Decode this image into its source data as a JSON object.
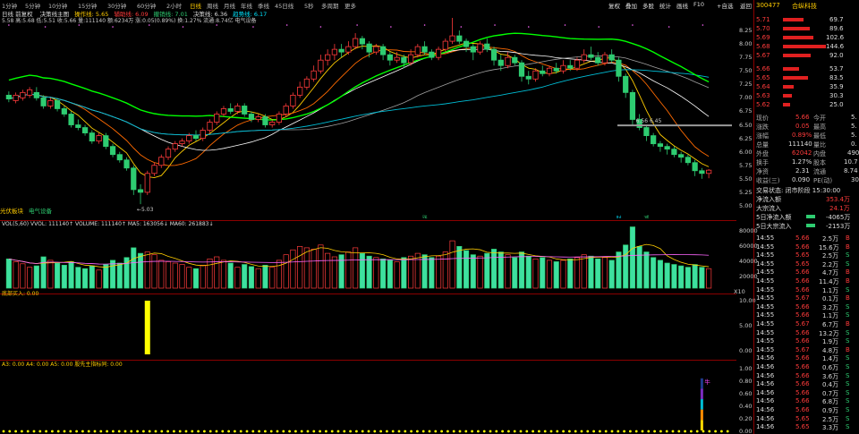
{
  "toolbar": {
    "periods": [
      "1分钟",
      "5分钟",
      "10分钟",
      "15分钟",
      "30分钟",
      "60分钟",
      "2小时",
      "日线",
      "周线",
      "月线",
      "年线",
      "季线",
      "45日线",
      "5秒",
      "多周期",
      "更多"
    ],
    "active_period": "日线",
    "right": [
      "复权",
      "叠加",
      "多股",
      "统计",
      "画线",
      "F10",
      "+自选",
      "返回"
    ]
  },
  "info_row": {
    "title": "日线 前复权",
    "items": [
      {
        "t": "决策线主图",
        "c": "#ddd"
      },
      {
        "t": "操作线: 5.65",
        "c": "#ffcc00"
      },
      {
        "t": "辅助线: 6.09",
        "c": "#ff3b3b"
      },
      {
        "t": "撤销线: 7.01",
        "c": "#2ecc71"
      },
      {
        "t": "决策线: 6.36",
        "c": "#ddd"
      },
      {
        "t": "趋势线: 6.17",
        "c": "#00e5ff"
      }
    ]
  },
  "info_row2": "5.58 高:5.68 低:5.51 收:5.66 量:111140 额:6234万 涨:0.05(0.89%) 换:1.27% 流通:8.74亿 电气设备",
  "sector_labels": [
    "光伏板块",
    "电气设备"
  ],
  "stock": {
    "code": "300477",
    "name": "合纵科技"
  },
  "order_book": {
    "asks": [
      {
        "label": "卖5",
        "price": "5.71",
        "vol": "69.7"
      },
      {
        "label": "卖4",
        "price": "5.70",
        "vol": "89.6"
      },
      {
        "label": "卖3",
        "price": "5.69",
        "vol": "102.6"
      },
      {
        "label": "卖2",
        "price": "5.68",
        "vol": "144.6"
      },
      {
        "label": "卖1",
        "price": "5.67",
        "vol": "92.0"
      }
    ],
    "bids": [
      {
        "label": "买1",
        "price": "5.66",
        "vol": "53.7"
      },
      {
        "label": "买2",
        "price": "5.65",
        "vol": "83.5"
      },
      {
        "label": "买3",
        "price": "5.64",
        "vol": "35.9"
      },
      {
        "label": "买4",
        "price": "5.63",
        "vol": "30.3"
      },
      {
        "label": "买5",
        "price": "5.62",
        "vol": "25.0"
      }
    ]
  },
  "quote": [
    [
      "现价",
      "5.66",
      "今开",
      "5."
    ],
    [
      "涨跌",
      "0.05",
      "最高",
      "5."
    ],
    [
      "涨幅",
      "0.89%",
      "最低",
      "5."
    ],
    [
      "总量",
      "111140",
      "量比",
      "0."
    ],
    [
      "外盘",
      "62042",
      "内盘",
      "490"
    ],
    [
      "换手",
      "1.27%",
      "股本",
      "10.7"
    ],
    [
      "净资",
      "2.31",
      "流通",
      "8.74"
    ],
    [
      "收益(三)",
      "0.090",
      "PE(动)",
      "30"
    ]
  ],
  "trade_status": "交易状态: 闭市阶段 15:30:00",
  "flows": [
    {
      "label": "净流入额",
      "value": "353.4万"
    },
    {
      "label": "大宗流入",
      "value": "24.1万"
    },
    {
      "label": "5日净流入额",
      "value": "-4065万"
    },
    {
      "label": "5日大宗流入",
      "value": "-2153万"
    }
  ],
  "ticks": [
    [
      "14:55",
      "5.66",
      "2.5万",
      "B"
    ],
    [
      "14:55",
      "5.66",
      "15.6万",
      "B"
    ],
    [
      "14:55",
      "5.65",
      "2.5万",
      "S"
    ],
    [
      "14:55",
      "5.65",
      "2.2万",
      "S"
    ],
    [
      "14:55",
      "5.66",
      "4.7万",
      "B"
    ],
    [
      "14:55",
      "5.66",
      "11.4万",
      "B"
    ],
    [
      "14:55",
      "5.66",
      "1.1万",
      "S"
    ],
    [
      "14:55",
      "5.67",
      "0.1万",
      "B"
    ],
    [
      "14:55",
      "5.66",
      "3.2万",
      "S"
    ],
    [
      "14:55",
      "5.66",
      "1.1万",
      "S"
    ],
    [
      "14:55",
      "5.67",
      "6.7万",
      "B"
    ],
    [
      "14:55",
      "5.66",
      "13.2万",
      "S"
    ],
    [
      "14:55",
      "5.66",
      "1.9万",
      "S"
    ],
    [
      "14:55",
      "5.67",
      "4.8万",
      "B"
    ],
    [
      "14:56",
      "5.66",
      "1.4万",
      "S"
    ],
    [
      "14:56",
      "5.66",
      "0.6万",
      "S"
    ],
    [
      "14:56",
      "5.66",
      "3.6万",
      "S"
    ],
    [
      "14:56",
      "5.66",
      "0.4万",
      "S"
    ],
    [
      "14:56",
      "5.66",
      "0.7万",
      "S"
    ],
    [
      "14:56",
      "5.66",
      "6.8万",
      "S"
    ],
    [
      "14:56",
      "5.66",
      "0.9万",
      "S"
    ],
    [
      "14:56",
      "5.65",
      "2.5万",
      "S"
    ],
    [
      "14:56",
      "5.65",
      "3.3万",
      "S"
    ]
  ],
  "price_axis": {
    "labels": [
      "8.25",
      "8.00",
      "7.75",
      "7.50",
      "7.25",
      "7.00",
      "6.75",
      "6.50",
      "6.25",
      "6.00",
      "5.75",
      "5.50",
      "5.25",
      "5.00"
    ]
  },
  "vol_header": "VOL(5,60) VVOL: 111140↑ VOLUME: 111140↑ MA5: 163056↓ MA60: 261883↓",
  "vol_axis": [
    "80000",
    "60000",
    "40000",
    "20000",
    "X10"
  ],
  "ind1_header": "底部买入: 0.00",
  "ind1_axis": [
    "10.00",
    "5.00",
    "0.00"
  ],
  "ind2_header": "A3: 0.00 A4: 0.00 A5: 0.00 股先主指标同: 0.00",
  "ind2_axis": [
    "1.00",
    "0.80",
    "0.60",
    "0.40",
    "0.20",
    "0.00"
  ],
  "annotations": {
    "high": "8.76",
    "low": "5.03",
    "mark": "6.56 6.45",
    "markers": [
      "涨",
      "财",
      "减"
    ],
    "signal": "牛"
  },
  "chart_data": {
    "type": "candlestick",
    "ylim": [
      4.9,
      8.35
    ],
    "candles": [
      [
        7.05,
        6.98,
        7.12,
        6.92
      ],
      [
        6.95,
        7.05,
        7.1,
        6.9
      ],
      [
        7.0,
        7.1,
        7.15,
        6.95
      ],
      [
        7.05,
        7.15,
        7.2,
        7.0
      ],
      [
        7.1,
        7.0,
        7.2,
        6.95
      ],
      [
        7.0,
        6.85,
        7.05,
        6.8
      ],
      [
        6.85,
        6.95,
        7.0,
        6.8
      ],
      [
        6.95,
        6.8,
        7.0,
        6.75
      ],
      [
        6.8,
        6.7,
        6.85,
        6.65
      ],
      [
        6.7,
        6.5,
        6.75,
        6.45
      ],
      [
        6.5,
        6.45,
        6.6,
        6.4
      ],
      [
        6.45,
        6.35,
        6.5,
        6.3
      ],
      [
        6.35,
        6.2,
        6.4,
        6.15
      ],
      [
        6.2,
        6.3,
        6.35,
        6.15
      ],
      [
        6.3,
        6.1,
        6.35,
        6.05
      ],
      [
        6.1,
        5.95,
        6.15,
        5.9
      ],
      [
        5.95,
        5.85,
        6.0,
        5.8
      ],
      [
        5.85,
        5.7,
        5.9,
        5.65
      ],
      [
        5.7,
        5.3,
        5.75,
        5.2
      ],
      [
        5.3,
        5.25,
        5.4,
        5.03
      ],
      [
        5.25,
        5.6,
        5.65,
        5.2
      ],
      [
        5.6,
        5.75,
        5.8,
        5.55
      ],
      [
        5.75,
        5.9,
        5.95,
        5.7
      ],
      [
        5.9,
        6.05,
        6.1,
        5.85
      ],
      [
        6.05,
        6.15,
        6.2,
        6.0
      ],
      [
        6.15,
        6.2,
        6.25,
        6.1
      ],
      [
        6.2,
        6.3,
        6.35,
        6.15
      ],
      [
        6.3,
        6.25,
        6.4,
        6.2
      ],
      [
        6.25,
        6.4,
        6.45,
        6.2
      ],
      [
        6.4,
        6.55,
        6.6,
        6.35
      ],
      [
        6.55,
        6.7,
        6.75,
        6.5
      ],
      [
        6.7,
        6.8,
        6.85,
        6.65
      ],
      [
        6.8,
        6.75,
        6.9,
        6.7
      ],
      [
        6.75,
        6.85,
        6.9,
        6.7
      ],
      [
        6.85,
        6.7,
        6.9,
        6.65
      ],
      [
        6.7,
        6.6,
        6.75,
        6.55
      ],
      [
        6.6,
        6.65,
        6.7,
        6.55
      ],
      [
        6.65,
        6.5,
        6.7,
        6.45
      ],
      [
        6.5,
        6.55,
        6.6,
        6.45
      ],
      [
        6.55,
        6.7,
        6.75,
        6.5
      ],
      [
        6.7,
        6.85,
        6.9,
        6.65
      ],
      [
        6.85,
        7.05,
        7.1,
        6.8
      ],
      [
        7.05,
        7.2,
        7.3,
        7.0
      ],
      [
        7.2,
        7.35,
        7.4,
        7.15
      ],
      [
        7.35,
        7.5,
        7.6,
        7.3
      ],
      [
        7.5,
        7.7,
        7.8,
        7.45
      ],
      [
        7.7,
        7.8,
        7.9,
        7.6
      ],
      [
        7.8,
        7.9,
        8.0,
        7.7
      ],
      [
        7.9,
        7.85,
        8.0,
        7.75
      ],
      [
        7.85,
        7.95,
        8.05,
        7.8
      ],
      [
        7.95,
        8.1,
        8.2,
        7.9
      ],
      [
        8.1,
        8.0,
        8.15,
        7.9
      ],
      [
        8.0,
        7.85,
        8.05,
        7.75
      ],
      [
        7.85,
        7.95,
        8.0,
        7.8
      ],
      [
        7.95,
        7.8,
        8.0,
        7.7
      ],
      [
        7.8,
        7.7,
        7.85,
        7.6
      ],
      [
        7.7,
        7.75,
        7.85,
        7.65
      ],
      [
        7.75,
        7.65,
        7.8,
        7.55
      ],
      [
        7.65,
        7.8,
        7.9,
        7.6
      ],
      [
        7.8,
        7.95,
        8.0,
        7.75
      ],
      [
        7.95,
        7.85,
        8.05,
        7.8
      ],
      [
        7.85,
        7.75,
        7.9,
        7.7
      ],
      [
        7.75,
        7.9,
        7.95,
        7.7
      ],
      [
        7.9,
        8.05,
        8.1,
        7.85
      ],
      [
        8.05,
        8.15,
        8.76,
        8.0
      ],
      [
        8.15,
        8.05,
        8.25,
        8.0
      ],
      [
        8.05,
        7.95,
        8.1,
        7.85
      ],
      [
        7.95,
        7.85,
        8.0,
        7.7
      ],
      [
        7.85,
        8.0,
        8.05,
        7.8
      ],
      [
        8.0,
        7.9,
        8.1,
        7.85
      ],
      [
        7.9,
        7.7,
        7.95,
        7.6
      ],
      [
        7.7,
        7.6,
        7.8,
        7.5
      ],
      [
        7.6,
        7.75,
        7.85,
        7.55
      ],
      [
        7.75,
        7.65,
        7.8,
        7.6
      ],
      [
        7.65,
        7.4,
        7.7,
        7.3
      ],
      [
        7.4,
        7.35,
        7.5,
        7.25
      ],
      [
        7.35,
        7.5,
        7.55,
        7.3
      ],
      [
        7.5,
        7.45,
        7.6,
        7.4
      ],
      [
        7.45,
        7.55,
        7.6,
        7.4
      ],
      [
        7.55,
        7.5,
        7.65,
        7.45
      ],
      [
        7.5,
        7.6,
        7.7,
        7.45
      ],
      [
        7.6,
        7.55,
        7.7,
        7.5
      ],
      [
        7.55,
        7.7,
        7.75,
        7.5
      ],
      [
        7.7,
        7.8,
        7.9,
        7.65
      ],
      [
        7.8,
        7.75,
        7.95,
        7.7
      ],
      [
        7.75,
        7.65,
        7.85,
        7.6
      ],
      [
        7.65,
        7.8,
        7.85,
        7.6
      ],
      [
        7.8,
        7.7,
        7.9,
        7.65
      ],
      [
        7.7,
        7.4,
        7.75,
        7.3
      ],
      [
        7.4,
        7.1,
        7.45,
        7.0
      ],
      [
        7.1,
        6.6,
        7.15,
        6.5
      ],
      [
        6.6,
        6.45,
        6.7,
        6.4
      ],
      [
        6.45,
        6.3,
        6.5,
        6.2
      ],
      [
        6.3,
        6.15,
        6.35,
        6.1
      ],
      [
        6.15,
        6.1,
        6.2,
        6.0
      ],
      [
        6.1,
        6.05,
        6.15,
        5.95
      ],
      [
        6.05,
        5.95,
        6.1,
        5.9
      ],
      [
        5.95,
        5.9,
        6.0,
        5.8
      ],
      [
        5.9,
        5.8,
        5.95,
        5.75
      ],
      [
        5.8,
        5.65,
        5.85,
        5.55
      ],
      [
        5.65,
        5.6,
        5.7,
        5.5
      ],
      [
        5.6,
        5.66,
        5.68,
        5.51
      ]
    ],
    "volume": [
      42,
      38,
      35,
      30,
      32,
      45,
      40,
      36,
      33,
      38,
      30,
      28,
      32,
      26,
      34,
      40,
      36,
      44,
      58,
      50,
      52,
      48,
      40,
      38,
      36,
      34,
      30,
      28,
      33,
      42,
      45,
      40,
      36,
      30,
      34,
      31,
      28,
      33,
      30,
      40,
      48,
      55,
      60,
      58,
      56,
      62,
      50,
      45,
      48,
      52,
      58,
      50,
      46,
      44,
      42,
      40,
      38,
      44,
      46,
      50,
      48,
      44,
      46,
      52,
      68,
      60,
      54,
      48,
      46,
      50,
      56,
      52,
      48,
      44,
      52,
      46,
      42,
      44,
      40,
      38,
      40,
      42,
      44,
      48,
      46,
      42,
      44,
      40,
      52,
      62,
      88,
      60,
      52,
      44,
      40,
      36,
      34,
      32,
      30,
      34,
      30,
      28
    ],
    "ind1": {
      "spike_index": 20,
      "value": 10.0
    },
    "ind2": {
      "spike_index": 100,
      "value": 0.82
    }
  }
}
